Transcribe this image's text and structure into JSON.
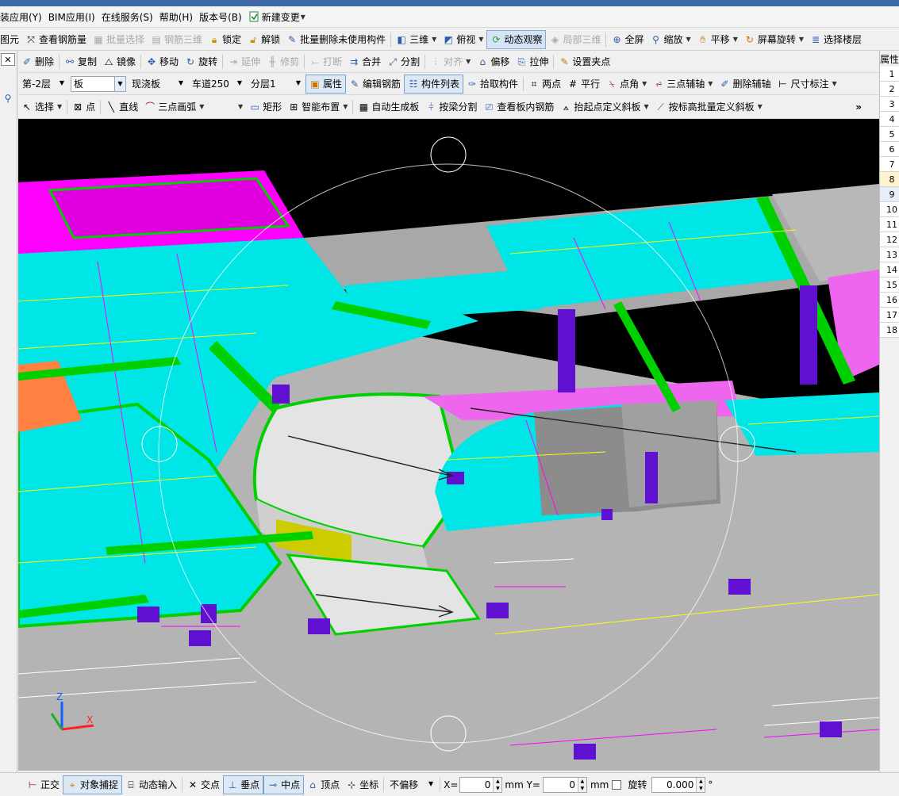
{
  "menubar": {
    "items": [
      "装应用(Y)",
      "BIM应用(I)",
      "在线服务(S)",
      "帮助(H)",
      "版本号(B)"
    ],
    "new_change_label": "新建变更"
  },
  "main_toolbar": {
    "items": [
      "图元",
      "查看钢筋量",
      "批量选择",
      "钢筋三维",
      "锁定",
      "解锁",
      "批量删除未使用构件",
      "三维",
      "俯视",
      "动态观察",
      "局部三维",
      "全屏",
      "缩放",
      "平移",
      "屏幕旋转",
      "选择楼层"
    ]
  },
  "edit_toolbar": {
    "items": [
      "删除",
      "复制",
      "镜像",
      "移动",
      "旋转",
      "延伸",
      "修剪",
      "打断",
      "合并",
      "分割",
      "对齐",
      "偏移",
      "拉伸",
      "设置夹点"
    ]
  },
  "prop_toolbar": {
    "floor": "第-2层",
    "type": "板",
    "subtype": "现浇板",
    "name": "车道250",
    "layer": "分层1",
    "items": [
      "属性",
      "编辑钢筋",
      "构件列表",
      "拾取构件",
      "两点",
      "平行",
      "点角",
      "三点辅轴",
      "删除辅轴",
      "尺寸标注"
    ]
  },
  "draw_toolbar": {
    "items": [
      "选择",
      "点",
      "直线",
      "三点画弧",
      "矩形",
      "智能布置",
      "自动生成板",
      "按梁分割",
      "查看板内钢筋",
      "抬起点定义斜板",
      "按标高批量定义斜板"
    ],
    "more": "»"
  },
  "right_panel": {
    "title": "属性",
    "rows": [
      "1",
      "2",
      "3",
      "4",
      "5",
      "6",
      "7",
      "8",
      "9",
      "10",
      "11",
      "12",
      "13",
      "14",
      "15",
      "16",
      "17",
      "18"
    ],
    "selected_row": "8"
  },
  "status_bar": {
    "items": [
      "正交",
      "对象捕捉",
      "动态输入",
      "交点",
      "垂点",
      "中点",
      "顶点",
      "坐标"
    ],
    "offset_mode": "不偏移",
    "x_label": "X=",
    "x_value": "0",
    "y_label": "mm Y=",
    "y_value": "0",
    "mm_label": "mm",
    "rotate_label": "旋转",
    "rotate_value": "0.000",
    "degree": "°"
  },
  "axes": {
    "z": "Z",
    "x": "X"
  },
  "colors": {
    "slab_cyan": "#00e5e5",
    "slab_magenta": "#ff00ff",
    "beam_green": "#00d000",
    "column_purple": "#6010d0",
    "ramp_grey": "#e4e4e4",
    "ground_grey": "#b4b4b4",
    "wall_grey": "#9a9a9a",
    "rebar_yellow": "#ffff00"
  }
}
